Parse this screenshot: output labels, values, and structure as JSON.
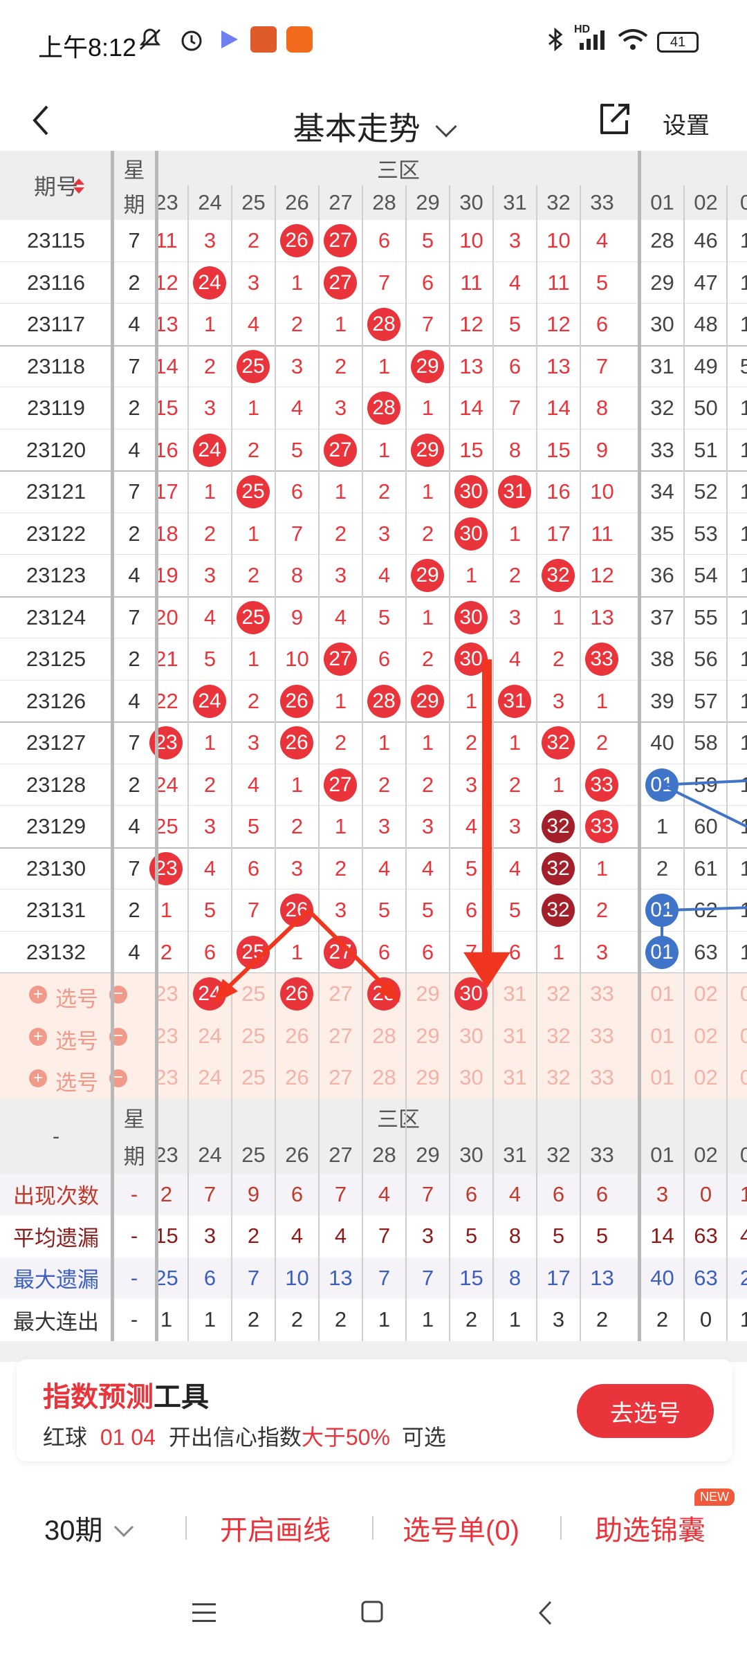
{
  "status": {
    "time": "上午8:12",
    "battery": "41",
    "hd": "HD"
  },
  "nav": {
    "title": "基本走势",
    "settings": "设置"
  },
  "header": {
    "period_label": "期号",
    "week_top": "星",
    "week_bottom": "期",
    "zone_label": "三区",
    "cols": [
      "23",
      "24",
      "25",
      "26",
      "27",
      "28",
      "29",
      "30",
      "31",
      "32",
      "33"
    ],
    "blue_cols": [
      "01",
      "02",
      "0"
    ]
  },
  "rows": [
    {
      "period": "23115",
      "week": "7",
      "vals": [
        "11",
        "3",
        "2",
        "26",
        "27",
        "6",
        "5",
        "10",
        "3",
        "10",
        "4"
      ],
      "blue": [
        "28",
        "46",
        "1"
      ]
    },
    {
      "period": "23116",
      "week": "2",
      "vals": [
        "12",
        "24",
        "3",
        "1",
        "27",
        "7",
        "6",
        "11",
        "4",
        "11",
        "5"
      ],
      "blue": [
        "29",
        "47",
        "1"
      ]
    },
    {
      "period": "23117",
      "week": "4",
      "vals": [
        "13",
        "1",
        "4",
        "2",
        "1",
        "28",
        "7",
        "12",
        "5",
        "12",
        "6"
      ],
      "blue": [
        "30",
        "48",
        "1"
      ]
    },
    {
      "period": "23118",
      "week": "7",
      "vals": [
        "14",
        "2",
        "25",
        "3",
        "2",
        "1",
        "29",
        "13",
        "6",
        "13",
        "7"
      ],
      "blue": [
        "31",
        "49",
        "5"
      ]
    },
    {
      "period": "23119",
      "week": "2",
      "vals": [
        "15",
        "3",
        "1",
        "4",
        "3",
        "28",
        "1",
        "14",
        "7",
        "14",
        "8"
      ],
      "blue": [
        "32",
        "50",
        "1"
      ]
    },
    {
      "period": "23120",
      "week": "4",
      "vals": [
        "16",
        "24",
        "2",
        "5",
        "27",
        "1",
        "29",
        "15",
        "8",
        "15",
        "9"
      ],
      "blue": [
        "33",
        "51",
        "1"
      ]
    },
    {
      "period": "23121",
      "week": "7",
      "vals": [
        "17",
        "1",
        "25",
        "6",
        "1",
        "2",
        "1",
        "30",
        "31",
        "16",
        "10"
      ],
      "blue": [
        "34",
        "52",
        "1"
      ]
    },
    {
      "period": "23122",
      "week": "2",
      "vals": [
        "18",
        "2",
        "1",
        "7",
        "2",
        "3",
        "2",
        "30",
        "1",
        "17",
        "11"
      ],
      "blue": [
        "35",
        "53",
        "1"
      ]
    },
    {
      "period": "23123",
      "week": "4",
      "vals": [
        "19",
        "3",
        "2",
        "8",
        "3",
        "4",
        "29",
        "1",
        "2",
        "32",
        "12"
      ],
      "blue": [
        "36",
        "54",
        "1"
      ]
    },
    {
      "period": "23124",
      "week": "7",
      "vals": [
        "20",
        "4",
        "25",
        "9",
        "4",
        "5",
        "1",
        "30",
        "3",
        "1",
        "13"
      ],
      "blue": [
        "37",
        "55",
        "1"
      ]
    },
    {
      "period": "23125",
      "week": "2",
      "vals": [
        "21",
        "5",
        "1",
        "10",
        "27",
        "6",
        "2",
        "30",
        "4",
        "2",
        "33"
      ],
      "blue": [
        "38",
        "56",
        "1"
      ]
    },
    {
      "period": "23126",
      "week": "4",
      "vals": [
        "22",
        "24",
        "2",
        "26",
        "1",
        "28",
        "29",
        "1",
        "31",
        "3",
        "1"
      ],
      "blue": [
        "39",
        "57",
        "1"
      ]
    },
    {
      "period": "23127",
      "week": "7",
      "vals": [
        "23",
        "1",
        "3",
        "26",
        "2",
        "1",
        "1",
        "2",
        "1",
        "32",
        "2"
      ],
      "blue": [
        "40",
        "58",
        "1"
      ]
    },
    {
      "period": "23128",
      "week": "2",
      "vals": [
        "24",
        "2",
        "4",
        "1",
        "27",
        "2",
        "2",
        "3",
        "2",
        "1",
        "33"
      ],
      "blue": [
        "01",
        "59",
        "1"
      ]
    },
    {
      "period": "23129",
      "week": "4",
      "vals": [
        "25",
        "3",
        "5",
        "2",
        "1",
        "3",
        "3",
        "4",
        "3",
        "32",
        "33"
      ],
      "blue": [
        "1",
        "60",
        "1"
      ]
    },
    {
      "period": "23130",
      "week": "7",
      "vals": [
        "23",
        "4",
        "6",
        "3",
        "2",
        "4",
        "4",
        "5",
        "4",
        "32",
        "1"
      ],
      "blue": [
        "2",
        "61",
        "1"
      ]
    },
    {
      "period": "23131",
      "week": "2",
      "vals": [
        "1",
        "5",
        "7",
        "26",
        "3",
        "5",
        "5",
        "6",
        "5",
        "32",
        "2"
      ],
      "blue": [
        "01",
        "62",
        "1"
      ]
    },
    {
      "period": "23132",
      "week": "4",
      "vals": [
        "2",
        "6",
        "25",
        "1",
        "27",
        "6",
        "6",
        "7",
        "6",
        "1",
        "3"
      ],
      "blue": [
        "01",
        "63",
        "1"
      ]
    }
  ],
  "select_rows": [
    {
      "label": "选号",
      "vals": [
        "23",
        "24",
        "25",
        "26",
        "27",
        "28",
        "29",
        "30",
        "31",
        "32",
        "33"
      ],
      "blue": [
        "01",
        "02",
        "0"
      ]
    },
    {
      "label": "选号",
      "vals": [
        "23",
        "24",
        "25",
        "26",
        "27",
        "28",
        "29",
        "30",
        "31",
        "32",
        "33"
      ],
      "blue": [
        "01",
        "02",
        "0"
      ]
    },
    {
      "label": "选号",
      "vals": [
        "23",
        "24",
        "25",
        "26",
        "27",
        "28",
        "29",
        "30",
        "31",
        "32",
        "33"
      ],
      "blue": [
        "01",
        "02",
        "0"
      ]
    }
  ],
  "stats": [
    {
      "label": "出现次数",
      "dash": "-",
      "vals": [
        "2",
        "7",
        "9",
        "6",
        "7",
        "4",
        "7",
        "6",
        "4",
        "6",
        "6"
      ],
      "blue": [
        "3",
        "0",
        "1"
      ],
      "color": "#c0392b"
    },
    {
      "label": "平均遗漏",
      "dash": "-",
      "vals": [
        "15",
        "3",
        "2",
        "4",
        "4",
        "7",
        "3",
        "5",
        "8",
        "5",
        "5"
      ],
      "blue": [
        "14",
        "63",
        "4"
      ],
      "color": "#8b1a1a"
    },
    {
      "label": "最大遗漏",
      "dash": "-",
      "vals": [
        "25",
        "6",
        "7",
        "10",
        "13",
        "7",
        "7",
        "15",
        "8",
        "17",
        "13"
      ],
      "blue": [
        "40",
        "63",
        "2"
      ],
      "color": "#3a5fbf"
    },
    {
      "label": "最大连出",
      "dash": "-",
      "vals": [
        "1",
        "1",
        "2",
        "2",
        "2",
        "1",
        "1",
        "2",
        "1",
        "3",
        "2"
      ],
      "blue": [
        "2",
        "0",
        "1"
      ],
      "color": "#333333"
    }
  ],
  "stats_header": {
    "dash": "-",
    "week_top": "星",
    "week_bottom": "期",
    "zone_label": "三区"
  },
  "tool": {
    "title_red": "指数预测",
    "title_black": "工具",
    "line_prefix": "红球",
    "line_nums": "01 04",
    "line_mid": "开出信心指数",
    "line_red": "大于50%",
    "line_suffix": "可选",
    "button": "去选号"
  },
  "bottombar": {
    "periods": "30期",
    "draw": "开启画线",
    "list": "选号单(0)",
    "assist": "助选锦囊",
    "new_badge": "NEW"
  },
  "colors": {
    "red": "#e8343a",
    "dark_red": "#a3202a",
    "blue": "#3f74c8",
    "pink_bg": "#fdeee8"
  }
}
